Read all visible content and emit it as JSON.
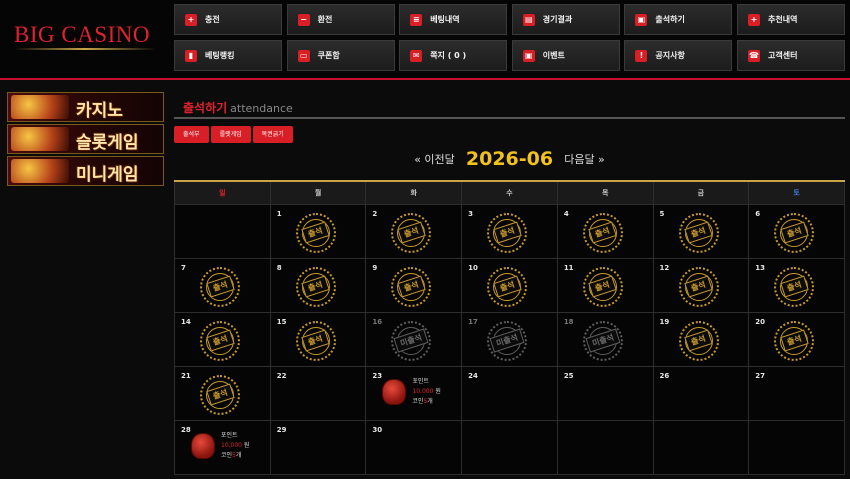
{
  "logo": "BIG CASINO",
  "nav": [
    {
      "label": "충전",
      "icon": "plus-square-icon",
      "glyph": "+"
    },
    {
      "label": "환전",
      "icon": "minus-square-icon",
      "glyph": "−"
    },
    {
      "label": "베팅내역",
      "icon": "history-icon",
      "glyph": "≡"
    },
    {
      "label": "경기결과",
      "icon": "scoreboard-icon",
      "glyph": "▤"
    },
    {
      "label": "출석하기",
      "icon": "gift-icon",
      "glyph": "▣"
    },
    {
      "label": "추천내역",
      "icon": "user-plus-icon",
      "glyph": "+"
    },
    {
      "label": "베팅랭킹",
      "icon": "ranking-icon",
      "glyph": "▮"
    },
    {
      "label": "쿠폰함",
      "icon": "coupon-icon",
      "glyph": "▭"
    },
    {
      "label": "쪽지 ( 0 )",
      "icon": "envelope-icon",
      "glyph": "✉"
    },
    {
      "label": "이벤트",
      "icon": "event-gift-icon",
      "glyph": "▣"
    },
    {
      "label": "공지사항",
      "icon": "notice-icon",
      "glyph": "!"
    },
    {
      "label": "고객센터",
      "icon": "phone-icon",
      "glyph": "☎"
    }
  ],
  "sidebar": [
    {
      "label": "카지노"
    },
    {
      "label": "슬롯게임"
    },
    {
      "label": "미니게임"
    }
  ],
  "page": {
    "title": "출석하기",
    "subtitle": "attendance"
  },
  "tabs": [
    "출석부",
    "룰렛게임",
    "복권긁기"
  ],
  "calendar": {
    "prev": "« 이전달",
    "month": "2026-06",
    "next": "다음달 »",
    "weekdays": [
      "일",
      "월",
      "화",
      "수",
      "목",
      "금",
      "토"
    ],
    "weekday_colors": [
      "#e0222e",
      "#cccccc",
      "#cccccc",
      "#cccccc",
      "#cccccc",
      "#cccccc",
      "#3a7bd5"
    ],
    "stamp_present": "출석",
    "stamp_absent": "미출석",
    "reward": {
      "label": "포인트",
      "points": "10,000",
      "points_unit": "원",
      "coin_label": "코인",
      "coins": "5",
      "coin_unit": "개"
    },
    "weeks": [
      [
        null,
        {
          "day": "1",
          "status": "present"
        },
        {
          "day": "2",
          "status": "present"
        },
        {
          "day": "3",
          "status": "present"
        },
        {
          "day": "4",
          "status": "present"
        },
        {
          "day": "5",
          "status": "present"
        },
        {
          "day": "6",
          "status": "present"
        }
      ],
      [
        {
          "day": "7",
          "status": "present"
        },
        {
          "day": "8",
          "status": "present"
        },
        {
          "day": "9",
          "status": "present"
        },
        {
          "day": "10",
          "status": "present"
        },
        {
          "day": "11",
          "status": "present"
        },
        {
          "day": "12",
          "status": "present"
        },
        {
          "day": "13",
          "status": "present"
        }
      ],
      [
        {
          "day": "14",
          "status": "present"
        },
        {
          "day": "15",
          "status": "present"
        },
        {
          "day": "16",
          "status": "absent"
        },
        {
          "day": "17",
          "status": "absent"
        },
        {
          "day": "18",
          "status": "absent"
        },
        {
          "day": "19",
          "status": "present"
        },
        {
          "day": "20",
          "status": "present"
        }
      ],
      [
        {
          "day": "21",
          "status": "present"
        },
        {
          "day": "22",
          "status": "none"
        },
        {
          "day": "23",
          "status": "reward"
        },
        {
          "day": "24",
          "status": "none"
        },
        {
          "day": "25",
          "status": "none"
        },
        {
          "day": "26",
          "status": "none"
        },
        {
          "day": "27",
          "status": "none"
        }
      ],
      [
        {
          "day": "28",
          "status": "reward"
        },
        {
          "day": "29",
          "status": "none"
        },
        {
          "day": "30",
          "status": "none"
        },
        null,
        null,
        null,
        null
      ]
    ]
  }
}
